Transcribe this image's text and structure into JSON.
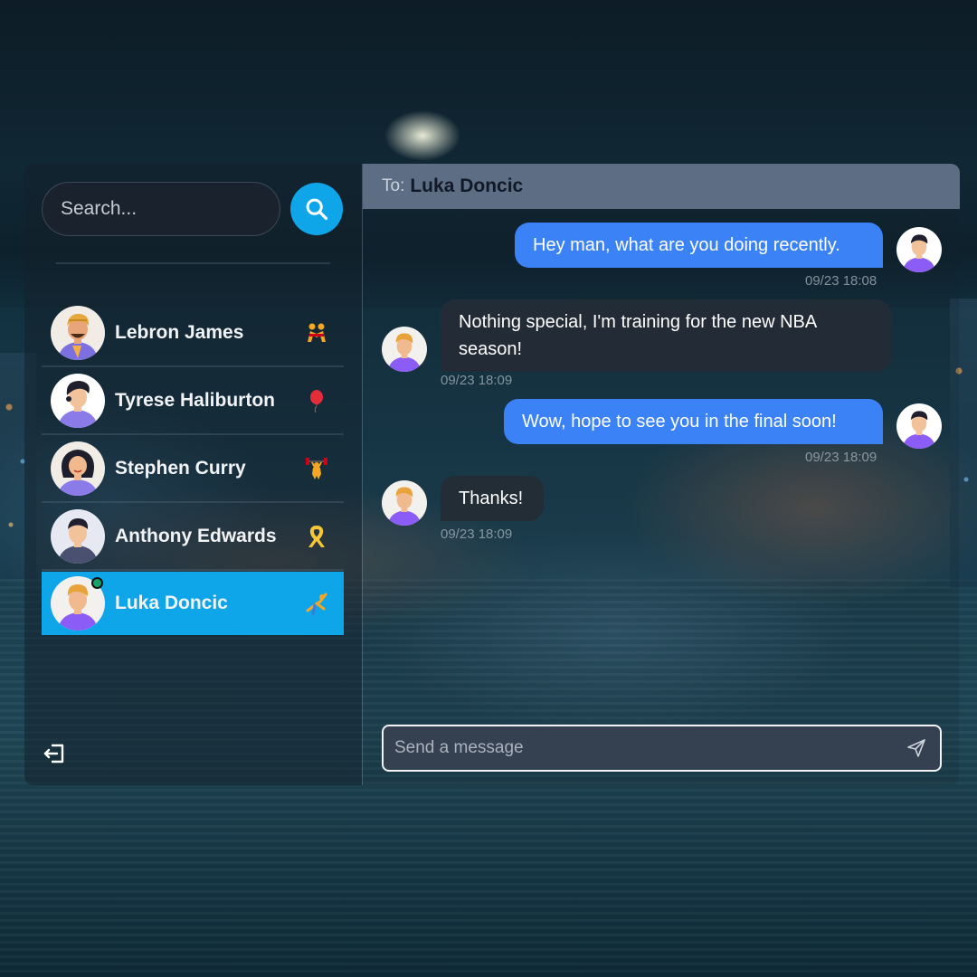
{
  "sidebar": {
    "search_placeholder": "Search...",
    "contacts": [
      {
        "name": "Lebron James",
        "emoji": "wrestlers-icon",
        "active": false,
        "online": false
      },
      {
        "name": "Tyrese Haliburton",
        "emoji": "balloon-icon",
        "active": false,
        "online": false
      },
      {
        "name": "Stephen Curry",
        "emoji": "weightlifter-icon",
        "active": false,
        "online": false
      },
      {
        "name": "Anthony Edwards",
        "emoji": "ribbon-icon",
        "active": false,
        "online": false
      },
      {
        "name": "Luka Doncic",
        "emoji": "cartwheel-icon",
        "active": true,
        "online": true
      }
    ]
  },
  "chat": {
    "to_label": "To:",
    "to_name": "Luka Doncic",
    "messages": [
      {
        "direction": "out",
        "text": "Hey man, what are you doing recently.",
        "time": "09/23 18:08"
      },
      {
        "direction": "in",
        "text": "Nothing special, I'm training for the new NBA season!",
        "time": "09/23 18:09"
      },
      {
        "direction": "out",
        "text": "Wow, hope to see you in the final soon!",
        "time": "09/23 18:09"
      },
      {
        "direction": "in",
        "text": "Thanks!",
        "time": "09/23 18:09"
      }
    ],
    "composer_placeholder": "Send a message"
  },
  "colors": {
    "accent": "#0ea5e9",
    "outgoing_bubble": "#3b82f6",
    "incoming_bubble": "#242c36",
    "header": "#64748b",
    "online": "#16a36a"
  }
}
